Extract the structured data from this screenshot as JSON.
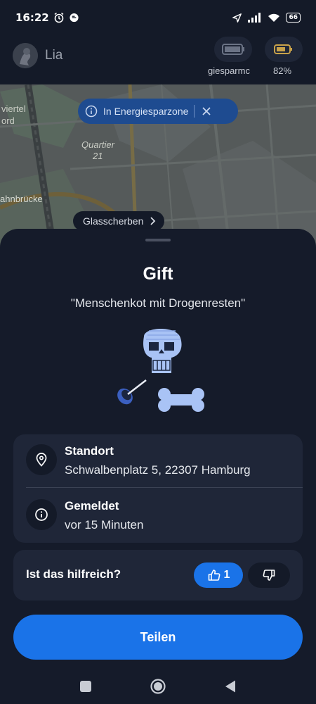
{
  "status_bar": {
    "time": "16:22",
    "battery": "66"
  },
  "header": {
    "username": "Lia",
    "energy_saver_label": "giesparmc",
    "battery_label": "82%"
  },
  "map": {
    "labels": [
      "viertel",
      "ord",
      "Quartier",
      "21",
      "ahnbrücke"
    ],
    "energy_zone_pill": "In Energiesparzone",
    "nearby_pill": "Glasscherben"
  },
  "detail": {
    "title": "Gift",
    "subtitle": "\"Menschenkot mit Drogenresten\""
  },
  "info": {
    "location_label": "Standort",
    "location_value": "Schwalbenplatz 5, 22307 Hamburg",
    "reported_label": "Gemeldet",
    "reported_value": "vor 15 Minuten"
  },
  "feedback": {
    "question": "Ist das hilfreich?",
    "upvotes": "1"
  },
  "share_label": "Teilen",
  "colors": {
    "accent": "#1a73e8",
    "sheet": "#151b2a",
    "card": "#1f2638",
    "pill": "#1e4b90"
  }
}
